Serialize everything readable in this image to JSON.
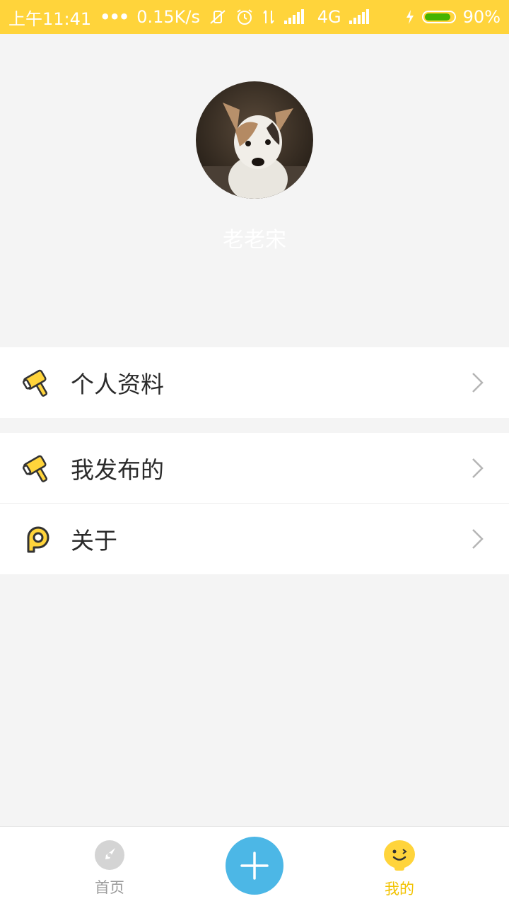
{
  "status_bar": {
    "time": "上午11:41",
    "dots": "•••",
    "speed": "0.15K/s",
    "network": "4G",
    "battery_text": "90%",
    "battery_level": 0.9,
    "colors": {
      "background": "#ffd43b",
      "battery_fill": "#44b300"
    },
    "icons": [
      "vibrate-off-icon",
      "alarm-icon",
      "data-transfer-icon",
      "signal-icon",
      "signal-icon",
      "charging-icon",
      "battery-icon"
    ]
  },
  "profile": {
    "username": "老老宋",
    "avatar_icon": "dog-avatar"
  },
  "menu": {
    "group1": [
      {
        "label": "个人资料",
        "icon": "hammer-icon"
      }
    ],
    "group2": [
      {
        "label": "我发布的",
        "icon": "hammer-icon"
      },
      {
        "label": "关于",
        "icon": "p-logo-icon"
      }
    ]
  },
  "bottom_nav": {
    "home_label": "首页",
    "add_icon": "plus-icon",
    "mine_label": "我的",
    "active": "mine",
    "colors": {
      "fab": "#4cb7e6",
      "active": "#f2c200",
      "inactive": "#9a9a9a"
    }
  }
}
